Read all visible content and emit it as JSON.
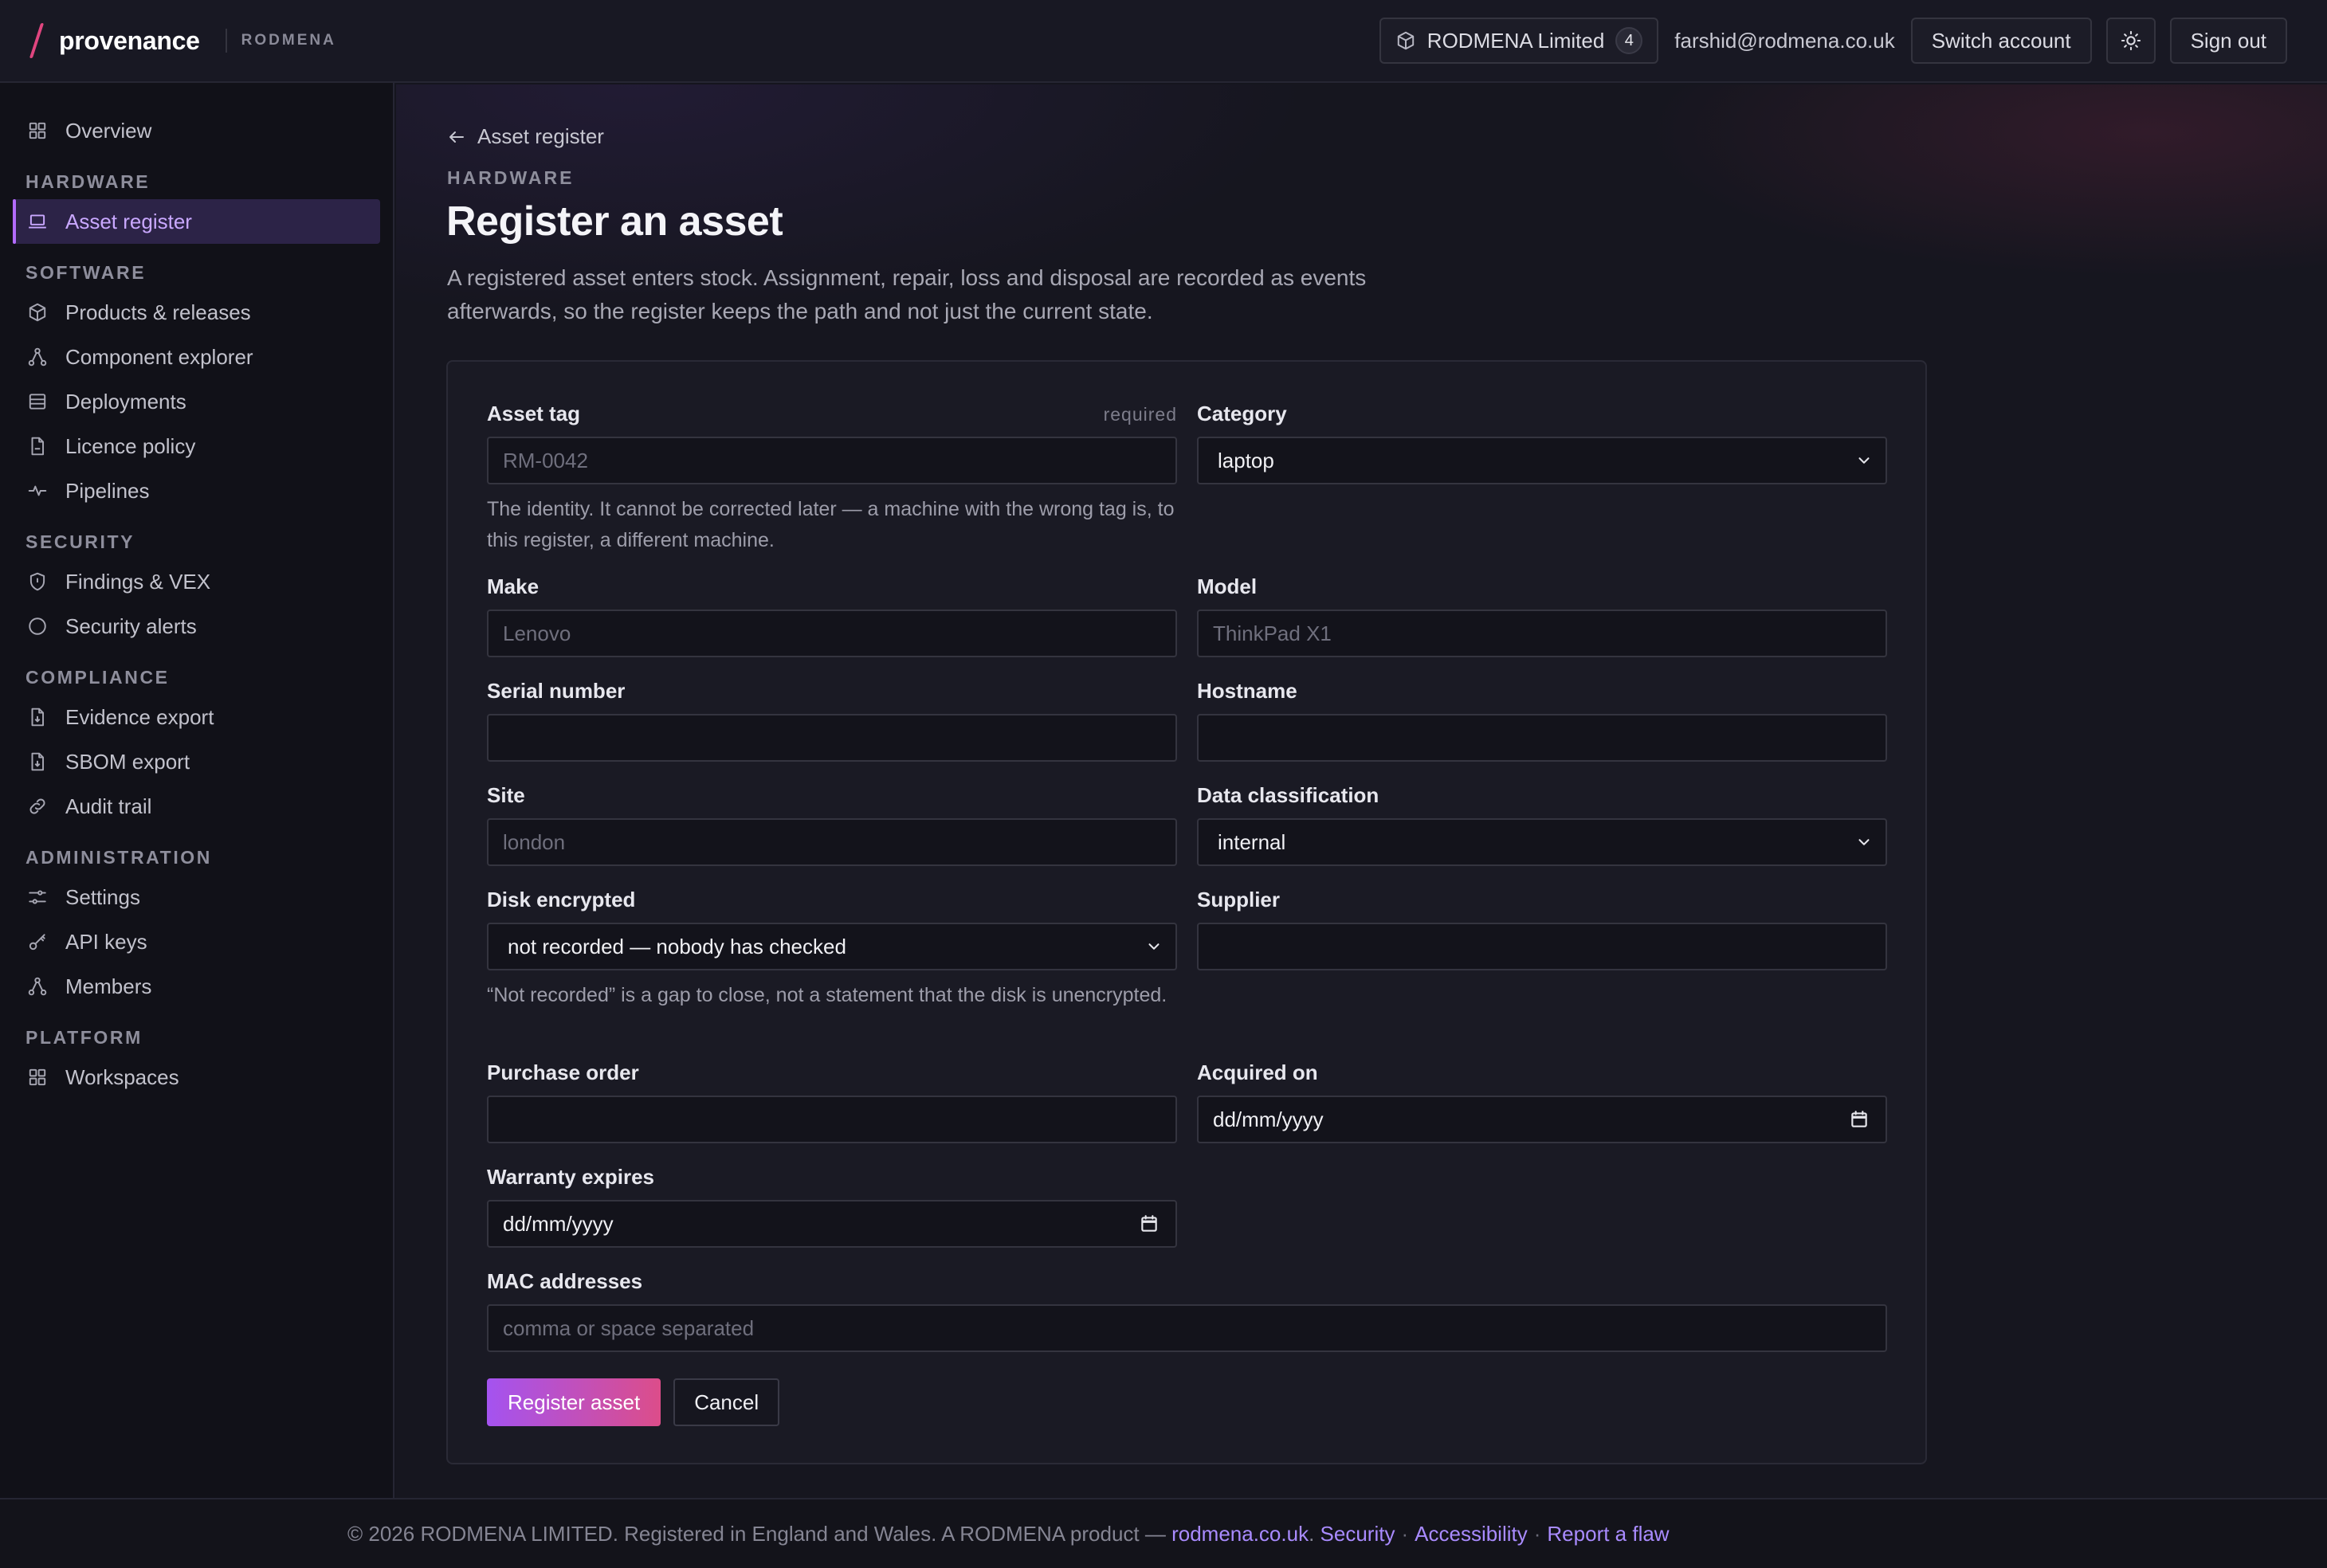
{
  "header": {
    "brand": "provenance",
    "org_tag": "RODMENA",
    "org_name": "RODMENA Limited",
    "org_count": "4",
    "email": "farshid@rodmena.co.uk",
    "switch_account": "Switch account",
    "sign_out": "Sign out"
  },
  "sidebar": {
    "overview": "Overview",
    "sections": {
      "hardware": "HARDWARE",
      "software": "SOFTWARE",
      "security": "SECURITY",
      "compliance": "COMPLIANCE",
      "administration": "ADMINISTRATION",
      "platform": "PLATFORM"
    },
    "items": {
      "asset_register": "Asset register",
      "products": "Products & releases",
      "components": "Component explorer",
      "deployments": "Deployments",
      "licence": "Licence policy",
      "pipelines": "Pipelines",
      "findings": "Findings & VEX",
      "alerts": "Security alerts",
      "evidence": "Evidence export",
      "sbom": "SBOM export",
      "audit": "Audit trail",
      "settings": "Settings",
      "api_keys": "API keys",
      "members": "Members",
      "workspaces": "Workspaces"
    }
  },
  "page": {
    "back_label": "Asset register",
    "eyebrow": "HARDWARE",
    "title": "Register an asset",
    "description": "A registered asset enters stock. Assignment, repair, loss and disposal are recorded as events afterwards, so the register keeps the path and not just the current state."
  },
  "form": {
    "asset_tag": {
      "label": "Asset tag",
      "required": "required",
      "placeholder": "RM-0042",
      "hint": "The identity. It cannot be corrected later — a machine with the wrong tag is, to this register, a different machine."
    },
    "category": {
      "label": "Category",
      "value": "laptop"
    },
    "make": {
      "label": "Make",
      "placeholder": "Lenovo"
    },
    "model": {
      "label": "Model",
      "placeholder": "ThinkPad X1"
    },
    "serial": {
      "label": "Serial number",
      "placeholder": ""
    },
    "hostname": {
      "label": "Hostname",
      "placeholder": ""
    },
    "site": {
      "label": "Site",
      "placeholder": "london"
    },
    "classification": {
      "label": "Data classification",
      "value": "internal"
    },
    "disk": {
      "label": "Disk encrypted",
      "value": "not recorded — nobody has checked",
      "hint": "“Not recorded” is a gap to close, not a statement that the disk is unencrypted."
    },
    "supplier": {
      "label": "Supplier",
      "placeholder": ""
    },
    "purchase_order": {
      "label": "Purchase order",
      "placeholder": ""
    },
    "acquired_on": {
      "label": "Acquired on",
      "value": "dd/mm/yyyy"
    },
    "warranty": {
      "label": "Warranty expires",
      "value": "dd/mm/yyyy"
    },
    "mac": {
      "label": "MAC addresses",
      "placeholder": "comma or space separated"
    },
    "submit": "Register asset",
    "cancel": "Cancel"
  },
  "footer": {
    "text": "© 2026 RODMENA LIMITED. Registered in England and Wales. A RODMENA product — ",
    "site_link": "rodmena.co.uk",
    "period": ".",
    "security": "Security",
    "accessibility": "Accessibility",
    "report": "Report a flaw",
    "sep": "·"
  },
  "colors": {
    "accent": "#b36bff",
    "link": "#a98bff",
    "background": "#16161f"
  }
}
